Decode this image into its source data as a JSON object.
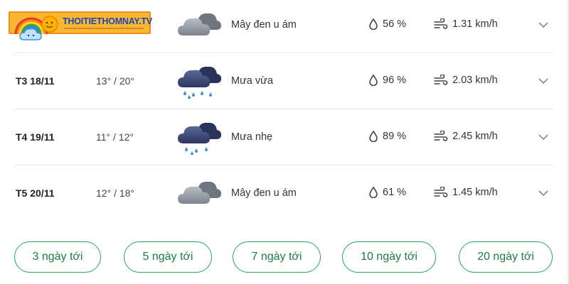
{
  "logo": {
    "text": "THOITIETHOMNAY.TV"
  },
  "rows": [
    {
      "day": "",
      "temp": "",
      "desc": "Mây đen u ám",
      "humidity": "56 %",
      "wind": "1.31 km/h",
      "icon": "overcast-cloud-icon"
    },
    {
      "day": "T3 18/11",
      "temp": "13° / 20°",
      "desc": "Mưa vừa",
      "humidity": "96 %",
      "wind": "2.03 km/h",
      "icon": "moderate-rain-icon"
    },
    {
      "day": "T4 19/11",
      "temp": "11° / 12°",
      "desc": "Mưa nhẹ",
      "humidity": "89 %",
      "wind": "2.45 km/h",
      "icon": "light-rain-icon"
    },
    {
      "day": "T5 20/11",
      "temp": "12° / 18°",
      "desc": "Mây đen u ám",
      "humidity": "61 %",
      "wind": "1.45 km/h",
      "icon": "overcast-cloud-icon"
    }
  ],
  "buttons": [
    "3 ngày tới",
    "5 ngày tới",
    "7 ngày tới",
    "10 ngày tới",
    "20 ngày tới"
  ],
  "colors": {
    "accent": "#27a35c",
    "separator": "#e6e6e6",
    "rain_cloud": "#3c4a7a",
    "overcast_cloud": "#8e939b"
  }
}
